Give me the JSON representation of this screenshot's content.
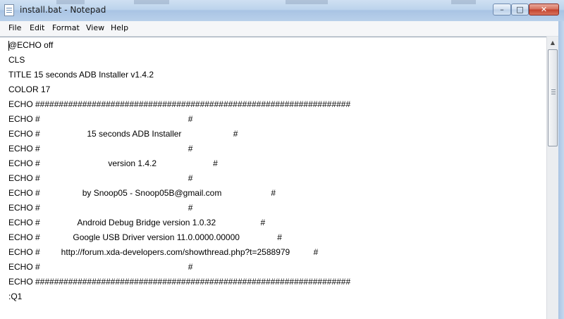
{
  "window": {
    "title": "install.bat - Notepad",
    "controls": {
      "minimize": "–",
      "maximize": "□",
      "close": "✕"
    }
  },
  "menu": [
    "File",
    "Edit",
    "Format",
    "View",
    "Help"
  ],
  "editor": {
    "lines": [
      "@ECHO off",
      "CLS",
      "TITLE 15 seconds ADB Installer v1.4.2",
      "COLOR 17",
      "ECHO ###################################################################",
      "ECHO #                                                               #",
      "ECHO #                    15 seconds ADB Installer                      #",
      "ECHO #                                                               #",
      "ECHO #                             version 1.4.2                        #",
      "ECHO #                                                               #",
      "ECHO #                  by Snoop05 - Snoop05B@gmail.com                     #",
      "ECHO #                                                               #",
      "ECHO #                Android Debug Bridge version 1.0.32                   #",
      "ECHO #              Google USB Driver version 11.0.0000.00000                #",
      "ECHO #         http://forum.xda-developers.com/showthread.php?t=2588979          #",
      "ECHO #                                                               #",
      "ECHO ###################################################################",
      ":Q1"
    ]
  },
  "colors": {
    "titlebar": "#bcd3ec",
    "editor_background": "#ffffff",
    "text": "#000000",
    "close_button": "#c2402a"
  },
  "icons": {
    "app": "notepad-icon"
  }
}
